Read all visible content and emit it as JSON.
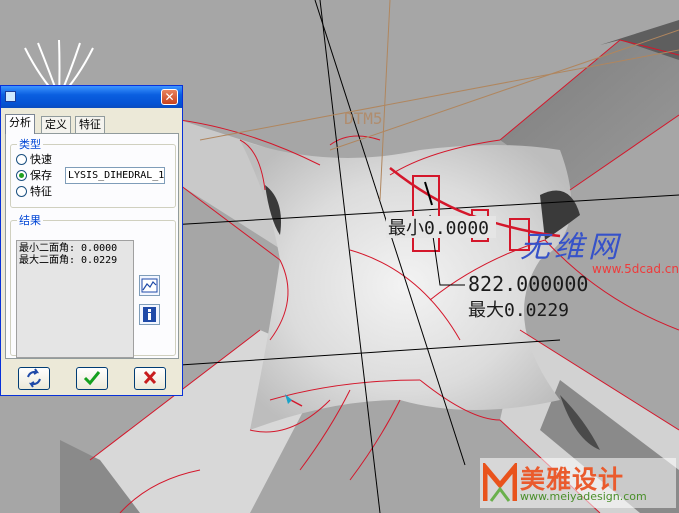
{
  "viewport": {
    "datum_label": "DTM5",
    "min_label": "最小0.0000",
    "dimension_value": "822.000000",
    "max_label": "最大0.0229",
    "geometry_color": "#d4172b",
    "surface_color": "#8c8c8c"
  },
  "dialog": {
    "title": "",
    "close_glyph": "✕",
    "tabs": [
      {
        "label": "分析",
        "active": true
      },
      {
        "label": "定义",
        "active": false
      },
      {
        "label": "特征",
        "active": false
      }
    ],
    "type_section": {
      "legend": "类型",
      "options": [
        {
          "label": "快速",
          "selected": false
        },
        {
          "label": "保存",
          "selected": true
        },
        {
          "label": "特征",
          "selected": false
        }
      ],
      "name_value": "LYSIS_DIHEDRAL_1"
    },
    "results_section": {
      "legend": "结果",
      "line1": "最小二面角: 0.0000",
      "line2": "最大二面角: 0.0229"
    },
    "side_buttons": [
      {
        "icon": "graph-icon"
      },
      {
        "icon": "info-icon"
      }
    ],
    "bottom_buttons": [
      {
        "icon": "recompute-icon"
      },
      {
        "icon": "ok-check-icon"
      },
      {
        "icon": "cancel-x-icon"
      }
    ],
    "accent_color": "#0a5fe0"
  },
  "watermarks": {
    "site_cn": "无维网",
    "site_url": "www.5dcad.cn",
    "brand_name": "美雅设计",
    "brand_url": "www.meiyadesign.com"
  }
}
